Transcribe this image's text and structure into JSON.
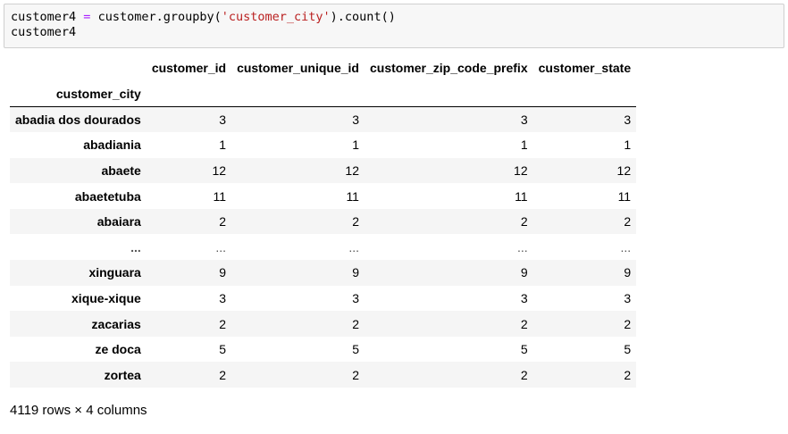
{
  "code": {
    "line1_var": "customer4",
    "line1_op": "=",
    "line1_call_a": "customer.groupby(",
    "line1_str": "'customer_city'",
    "line1_call_b": ").count()",
    "line2": "customer4"
  },
  "table": {
    "columns": [
      "customer_id",
      "customer_unique_id",
      "customer_zip_code_prefix",
      "customer_state"
    ],
    "index_name": "customer_city",
    "rows": [
      {
        "city": "abadia dos dourados",
        "values": [
          "3",
          "3",
          "3",
          "3"
        ]
      },
      {
        "city": "abadiania",
        "values": [
          "1",
          "1",
          "1",
          "1"
        ]
      },
      {
        "city": "abaete",
        "values": [
          "12",
          "12",
          "12",
          "12"
        ]
      },
      {
        "city": "abaetetuba",
        "values": [
          "11",
          "11",
          "11",
          "11"
        ]
      },
      {
        "city": "abaiara",
        "values": [
          "2",
          "2",
          "2",
          "2"
        ]
      },
      {
        "city": "...",
        "values": [
          "...",
          "...",
          "...",
          "..."
        ]
      },
      {
        "city": "xinguara",
        "values": [
          "9",
          "9",
          "9",
          "9"
        ]
      },
      {
        "city": "xique-xique",
        "values": [
          "3",
          "3",
          "3",
          "3"
        ]
      },
      {
        "city": "zacarias",
        "values": [
          "2",
          "2",
          "2",
          "2"
        ]
      },
      {
        "city": "ze doca",
        "values": [
          "5",
          "5",
          "5",
          "5"
        ]
      },
      {
        "city": "zortea",
        "values": [
          "2",
          "2",
          "2",
          "2"
        ]
      }
    ]
  },
  "footer": "4119 rows × 4 columns",
  "colors": {
    "keyword_operator": "#aa22ff",
    "string": "#ba2121",
    "code_bg": "#f7f7f7",
    "row_stripe": "#f5f5f5"
  }
}
